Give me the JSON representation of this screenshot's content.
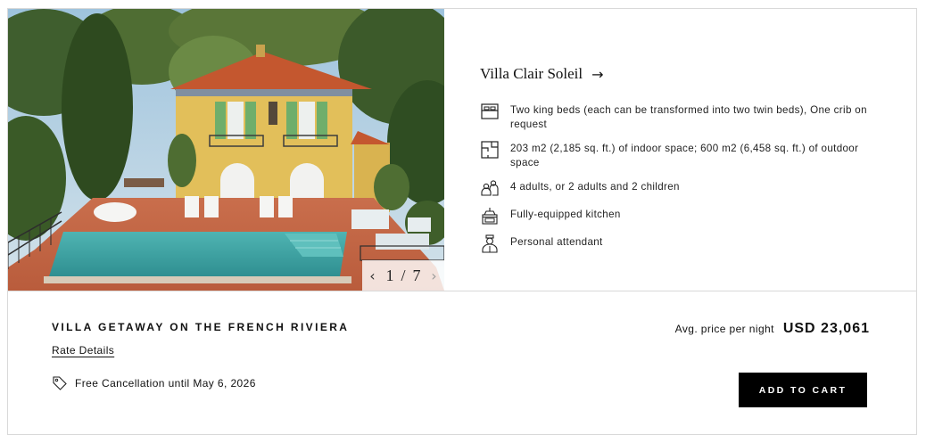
{
  "photo": {
    "alt": "Villa Clair Soleil",
    "pager": {
      "current": "1",
      "separator": "/",
      "total": "7"
    }
  },
  "villa": {
    "name": "Villa Clair Soleil",
    "link_icon": "arrow-right-icon"
  },
  "features": [
    {
      "icon": "bed-icon",
      "text": "Two king beds (each can be transformed into two twin beds), One crib on request"
    },
    {
      "icon": "floorplan-icon",
      "text": "203 m2 (2,185 sq. ft.) of indoor space; 600 m2 (6,458 sq. ft.) of outdoor space"
    },
    {
      "icon": "guests-icon",
      "text": "4 adults, or 2 adults and 2 children"
    },
    {
      "icon": "kitchen-icon",
      "text": "Fully-equipped kitchen"
    },
    {
      "icon": "attendant-icon",
      "text": "Personal attendant"
    }
  ],
  "package": {
    "title": "VILLA GETAWAY ON THE FRENCH RIVIERA",
    "rate_details_label": "Rate Details",
    "cancellation": "Free Cancellation until May 6, 2026"
  },
  "price": {
    "label": "Avg. price per night",
    "value": "USD 23,061"
  },
  "cart": {
    "button_label": "ADD TO CART"
  },
  "colors": {
    "accent": "#000000",
    "border": "#d9d9d9",
    "pool": "#3aa3a3",
    "roof": "#c4572f",
    "facade": "#e7c45e"
  }
}
